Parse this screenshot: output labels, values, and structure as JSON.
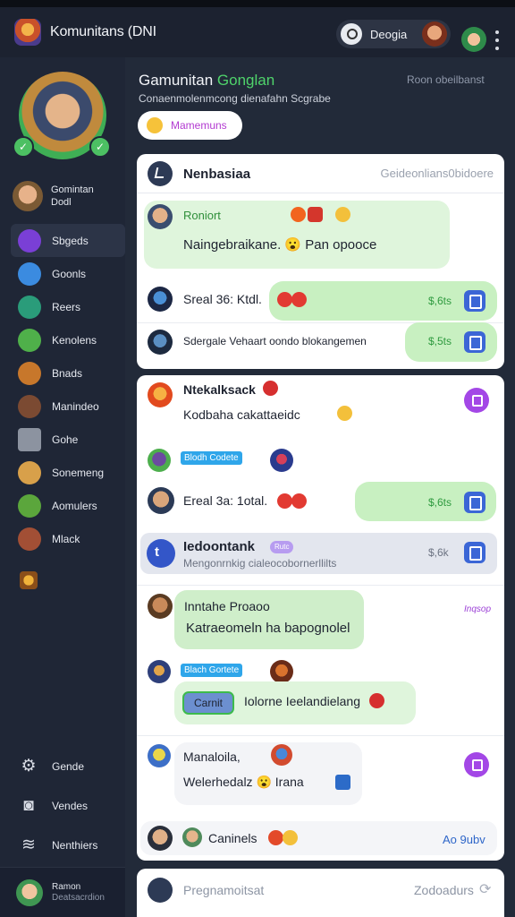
{
  "app": {
    "title": "Komunitans (DNI"
  },
  "topbar": {
    "user_name": "Deogia"
  },
  "sidebar": {
    "user": {
      "line1": "Gomintan",
      "line2": "Dodl"
    },
    "items": [
      {
        "label": "Sbgeds",
        "color": "#7a3fd6"
      },
      {
        "label": "Goonls",
        "color": "#3b8be0"
      },
      {
        "label": "Reers",
        "color": "#2a9c7a"
      },
      {
        "label": "Kenolens",
        "color": "#4fb04a"
      },
      {
        "label": "Bnads",
        "color": "#c7772b"
      },
      {
        "label": "Manindeo",
        "color": "#7b4a32"
      },
      {
        "label": "Gohe",
        "color": "#8c93a0"
      },
      {
        "label": "Sonemeng",
        "color": "#d8a04a"
      },
      {
        "label": "Aomulers",
        "color": "#5ba63c"
      },
      {
        "label": "Mlack",
        "color": "#a24f35"
      }
    ],
    "bottom": [
      {
        "label": "Gende",
        "icon": "gear-icon"
      },
      {
        "label": "Vendes",
        "icon": "camera-icon"
      },
      {
        "label": "Nenthiers",
        "icon": "wifi-icon"
      }
    ],
    "footer": {
      "name": "Ramon",
      "sub": "Deatsacrdion"
    }
  },
  "main": {
    "title_part1": "Gamunitan ",
    "title_part2": "Gonglan",
    "subtitle": "Conaenmolenmcong dienafahn Scgrabe",
    "header_right": "Roon obeilbanst",
    "chip_label": "Mamemuns"
  },
  "card1": {
    "title": "Nenbasiaa",
    "right": "Geideonlians0bidoere",
    "msg_name": "Roniort",
    "msg_text": "Naingebraikane. 😮 Pan opooce",
    "row1_text": "Sreal 36: Ktdl.",
    "row1_price": "$,6ts",
    "row2_text": "Sdergale Vehaart oondo blokangemen",
    "row2_price": "$,5ts"
  },
  "card2": {
    "title": "Ntekalksack",
    "text": "Kodbaha cakattaeidc",
    "tag1": "Blodh Codete",
    "row_text": "Ereal 3a: 1otal.",
    "row_price": "$,6ts",
    "high_title": "Iedoontank",
    "high_badge": "Rutc",
    "high_sub": "Mengonrnkig cialeocobornerllilts",
    "high_price": "$,6k",
    "msg2_title": "Inntahe Proaoo",
    "msg2_text": "Katraeomeln ha bapognolel",
    "msg2_link": "Inqsop",
    "tag2": "Blach Gortete",
    "chip_btn": "Carnit",
    "msg3_text": "Iolorne Ieelandielang",
    "msg4_title": "Manaloila,",
    "msg4_text": "Welerhedalz 😮 Irana",
    "footer_text": "Caninels",
    "footer_right": "Ao 9ubv"
  },
  "card3": {
    "placeholder": "Pregnamoitsat",
    "right": "Zodoadurs"
  }
}
